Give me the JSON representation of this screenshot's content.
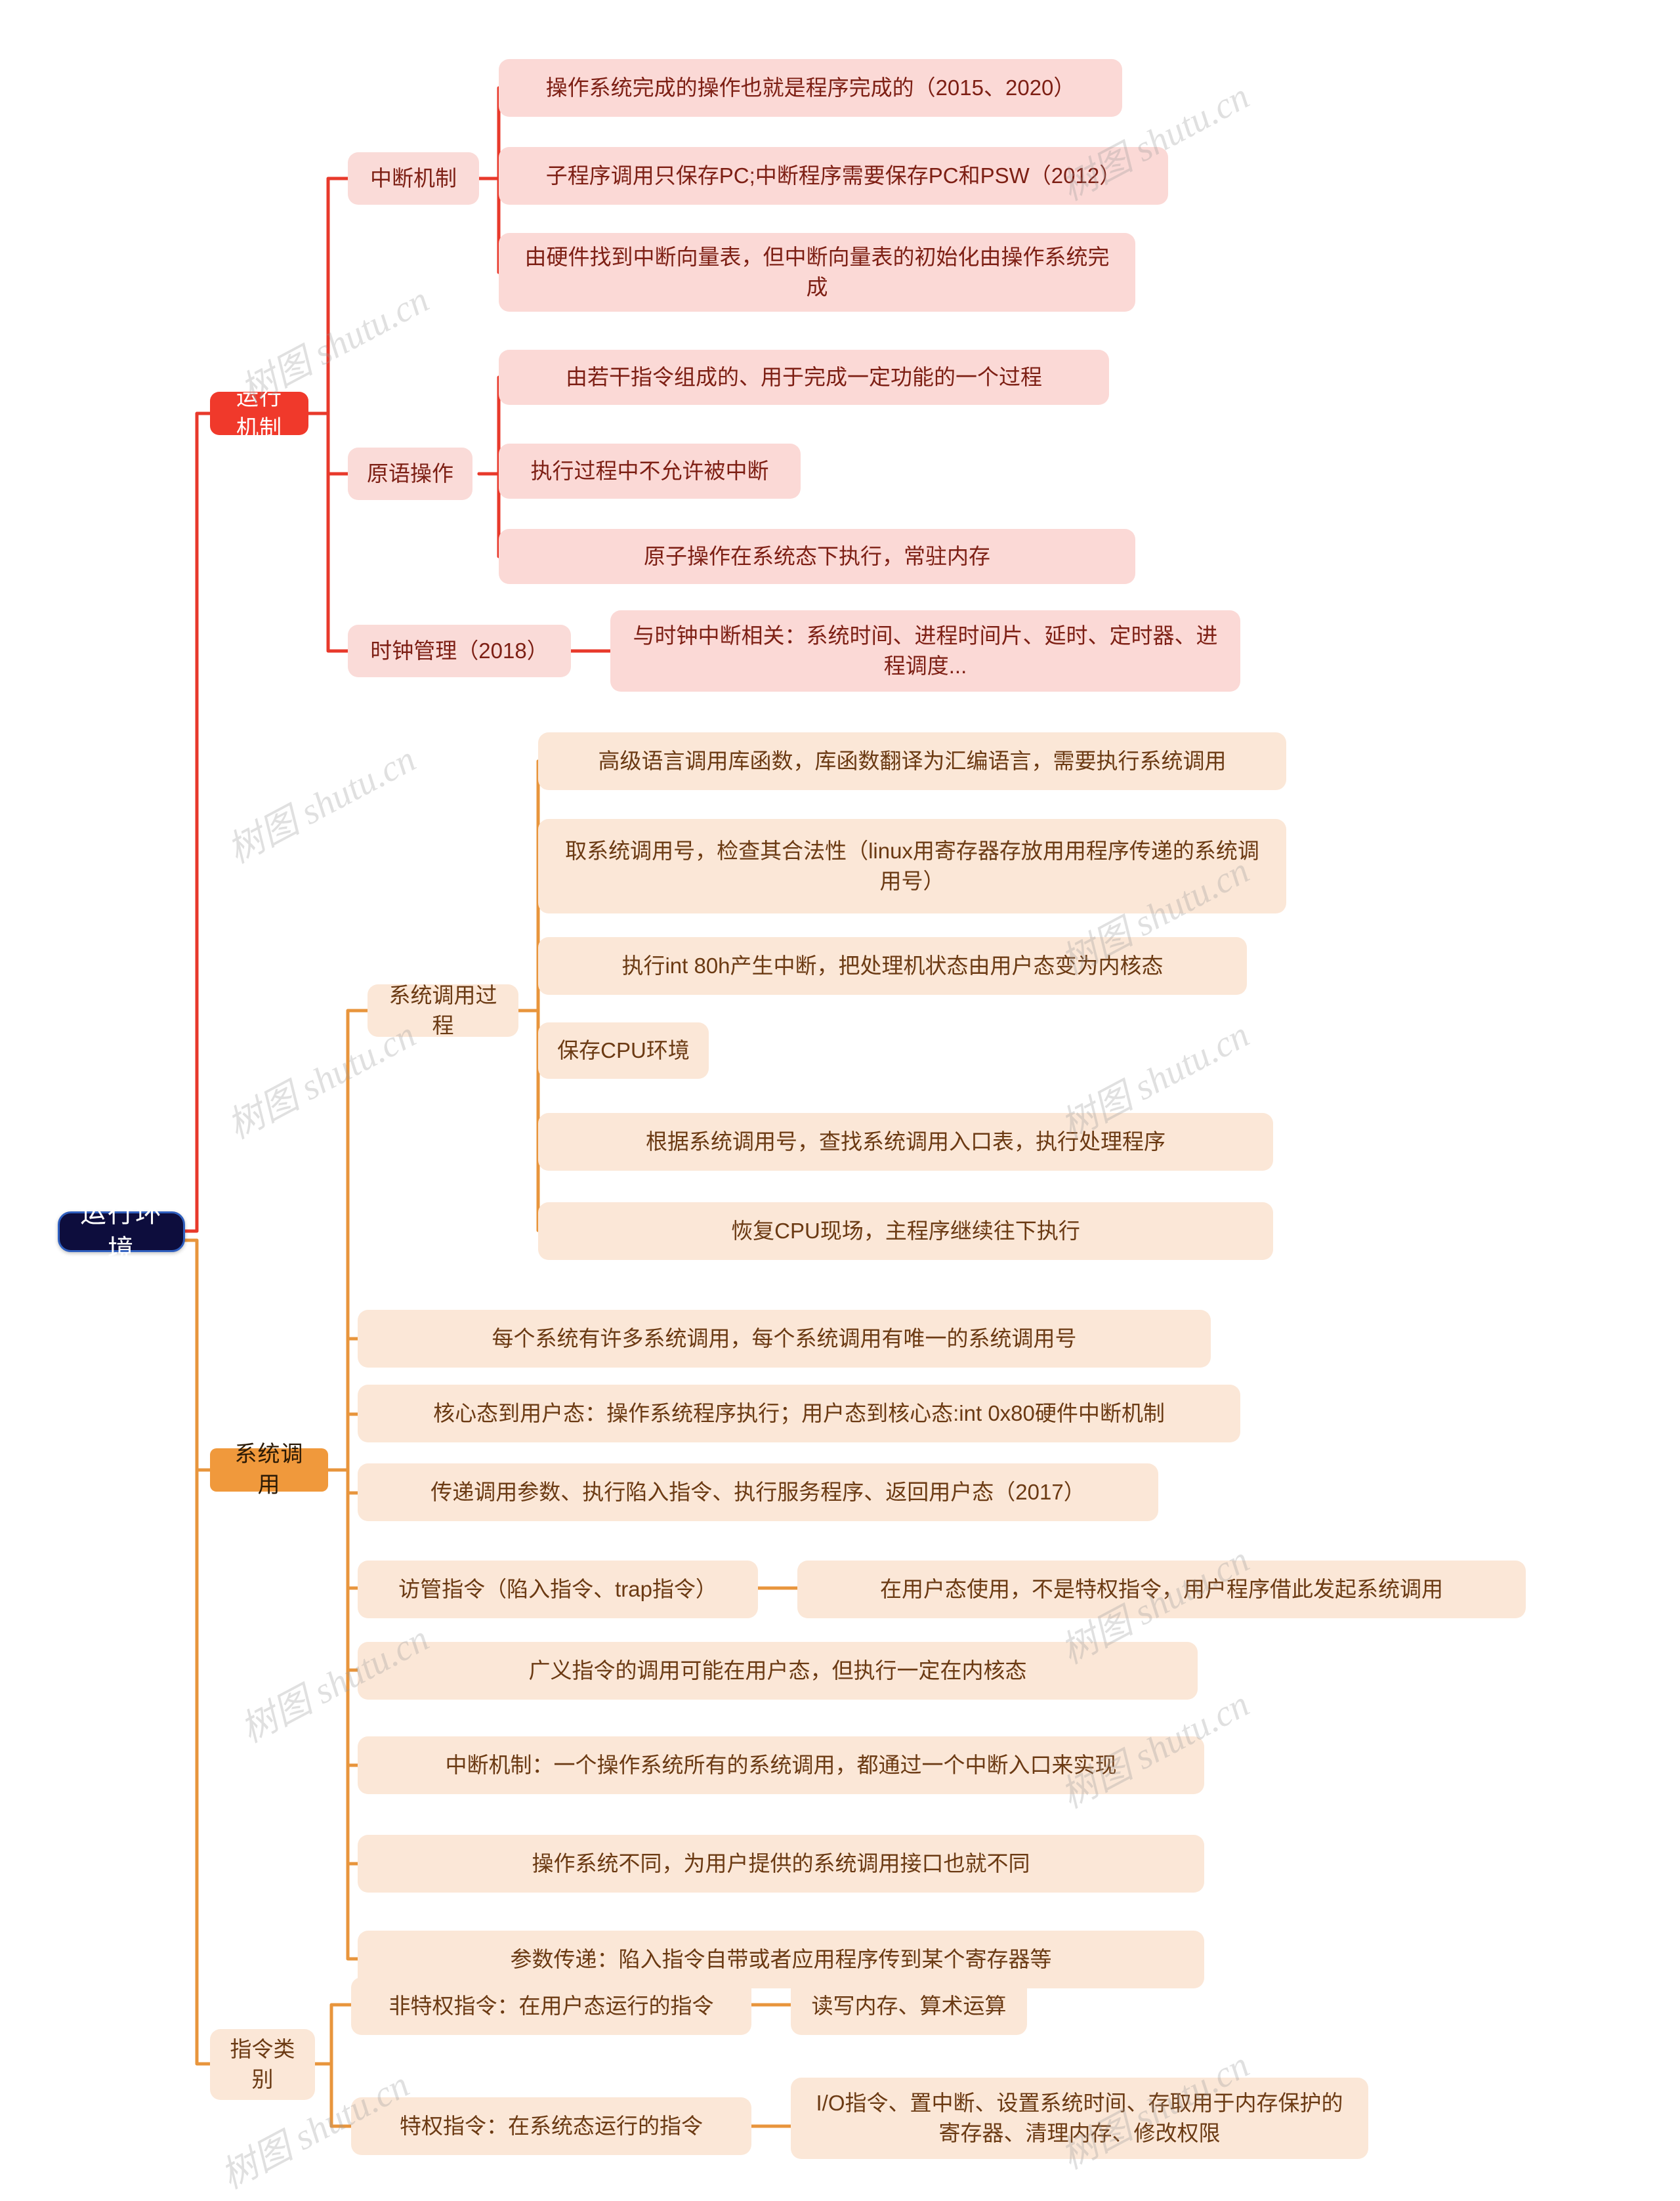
{
  "meta": {
    "title": "运行环境 思维导图",
    "watermark": "树图 shutu.cn",
    "colors": {
      "root_bg": "#0d0d3d",
      "root_border": "#2f5fbf",
      "branch_red": "#f0392b",
      "branch_orange": "#f0993c",
      "leaf_red_bg": "#fbd9d6",
      "leaf_red_text": "#7d1f14",
      "leaf_orange_bg": "#fbe7d7",
      "leaf_orange_text": "#6b3a13",
      "link_red": "#e8392b",
      "link_orange": "#e8953c"
    }
  },
  "root": {
    "label": "运行环境"
  },
  "branches": [
    {
      "label": "运行机制",
      "color": "red",
      "children": [
        {
          "label": "中断机制",
          "children": [
            {
              "label": "操作系统完成的操作也就是程序完成的（2015、2020）"
            },
            {
              "label": "子程序调用只保存PC;中断程序需要保存PC和PSW（2012）"
            },
            {
              "label": "由硬件找到中断向量表，但中断向量表的初始化由操作系统完成"
            }
          ]
        },
        {
          "label": "原语操作",
          "children": [
            {
              "label": "由若干指令组成的、用于完成一定功能的一个过程"
            },
            {
              "label": "执行过程中不允许被中断"
            },
            {
              "label": "原子操作在系统态下执行，常驻内存"
            }
          ]
        },
        {
          "label": "时钟管理（2018）",
          "children": [
            {
              "label": "与时钟中断相关：系统时间、进程时间片、延时、定时器、进程调度..."
            }
          ]
        }
      ]
    },
    {
      "label": "系统调用",
      "color": "orange",
      "children": [
        {
          "label": "系统调用过程",
          "children": [
            {
              "label": "高级语言调用库函数，库函数翻译为汇编语言，需要执行系统调用"
            },
            {
              "label": "取系统调用号，检查其合法性（linux用寄存器存放用用程序传递的系统调用号）"
            },
            {
              "label": "执行int 80h产生中断，把处理机状态由用户态变为内核态"
            },
            {
              "label": "保存CPU环境"
            },
            {
              "label": "根据系统调用号，查找系统调用入口表，执行处理程序"
            },
            {
              "label": "恢复CPU现场，主程序继续往下执行"
            }
          ]
        },
        {
          "label": "每个系统有许多系统调用，每个系统调用有唯一的系统调用号",
          "children": []
        },
        {
          "label": "核心态到用户态：操作系统程序执行；用户态到核心态:int 0x80硬件中断机制",
          "children": []
        },
        {
          "label": "传递调用参数、执行陷入指令、执行服务程序、返回用户态（2017）",
          "children": []
        },
        {
          "label": "访管指令（陷入指令、trap指令）",
          "children": [
            {
              "label": "在用户态使用，不是特权指令，用户程序借此发起系统调用"
            }
          ]
        },
        {
          "label": "广义指令的调用可能在用户态，但执行一定在内核态",
          "children": []
        },
        {
          "label": "中断机制：一个操作系统所有的系统调用，都通过一个中断入口来实现",
          "children": []
        },
        {
          "label": "操作系统不同，为用户提供的系统调用接口也就不同",
          "children": []
        },
        {
          "label": "参数传递：陷入指令自带或者应用程序传到某个寄存器等",
          "children": []
        }
      ]
    },
    {
      "label": "指令类别",
      "color": "orange",
      "is_sub": true,
      "children": [
        {
          "label": "非特权指令：在用户态运行的指令",
          "children": [
            {
              "label": "读写内存、算术运算"
            }
          ]
        },
        {
          "label": "特权指令：在系统态运行的指令",
          "children": [
            {
              "label": "I/O指令、置中断、设置系统时间、存取用于内存保护的寄存器、清理内存、修改权限"
            }
          ]
        }
      ]
    }
  ]
}
